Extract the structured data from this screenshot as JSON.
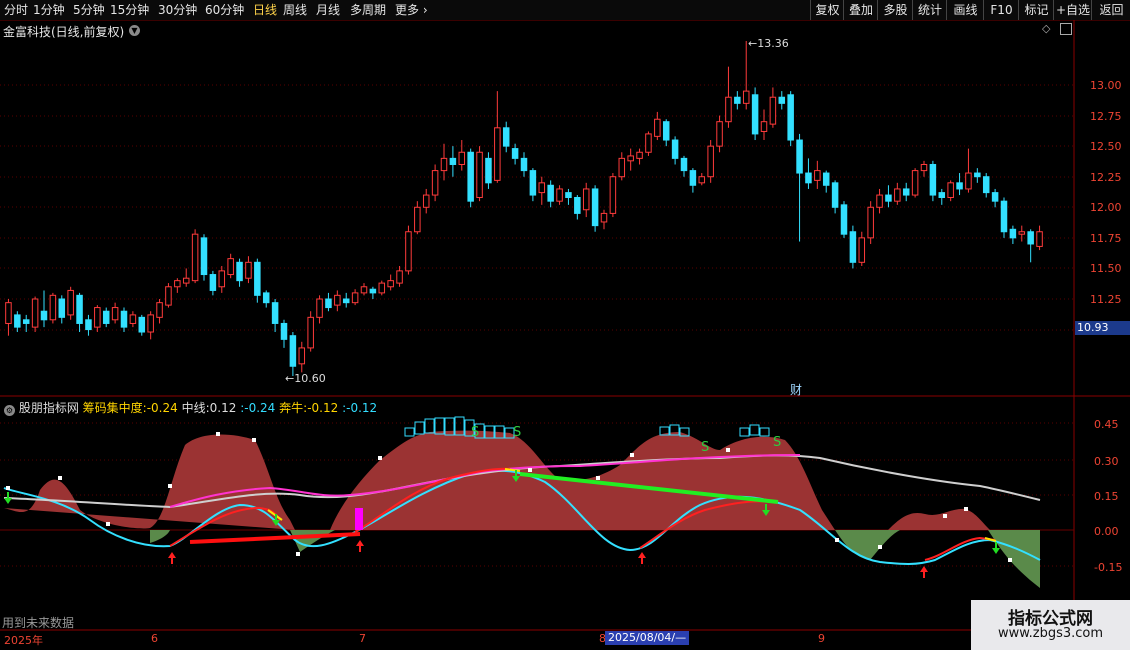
{
  "toolbar": {
    "timeframes": [
      "分时",
      "1分钟",
      "5分钟",
      "15分钟",
      "30分钟",
      "60分钟",
      "日线",
      "周线",
      "月线",
      "多周期",
      "更多"
    ],
    "active": "日线",
    "more_arrow": "chevron-right-icon",
    "tools": [
      "复权",
      "叠加",
      "多股",
      "统计",
      "画线",
      "F10",
      "标记",
      "+自选",
      "返回"
    ]
  },
  "main_chart": {
    "title": "金富科技(日线,前复权)",
    "high_label": "13.36",
    "low_label": "10.60",
    "current_price": "10.93",
    "event_marker": "财",
    "y_ticks": [
      "13.00",
      "12.75",
      "12.50",
      "12.25",
      "12.00",
      "11.75",
      "11.50",
      "11.25"
    ]
  },
  "indicator": {
    "name": "股朋指标网",
    "legend": [
      {
        "label": "筹码集中度:",
        "value": "-0.24",
        "color": "#ffd400"
      },
      {
        "label": "中线:",
        "value": "0.12",
        "color": "#dddddd"
      },
      {
        "label": ":",
        "value": "-0.24",
        "color": "#33ddff"
      },
      {
        "label": "奔牛:",
        "value": "-0.12",
        "color": "#ffd400"
      },
      {
        "label": ":",
        "value": "-0.12",
        "color": "#33ddff"
      }
    ],
    "y_ticks": [
      "0.45",
      "0.30",
      "0.15",
      "0.00",
      "-0.15"
    ],
    "sell_marker": "S",
    "warning": "用到未来数据"
  },
  "x_axis": {
    "labels": [
      "2025年",
      "6",
      "7",
      "8",
      "9"
    ],
    "cursor_date": "2025/08/04/—"
  },
  "watermark": {
    "line1": "指标公式网",
    "line2": "www.zbgs3.com"
  },
  "colors": {
    "up": "#ff3b3b",
    "down": "#33e0ff",
    "area_up": "#9b3333",
    "area_down": "#5a8a4a",
    "axis": "#ff3333"
  }
}
